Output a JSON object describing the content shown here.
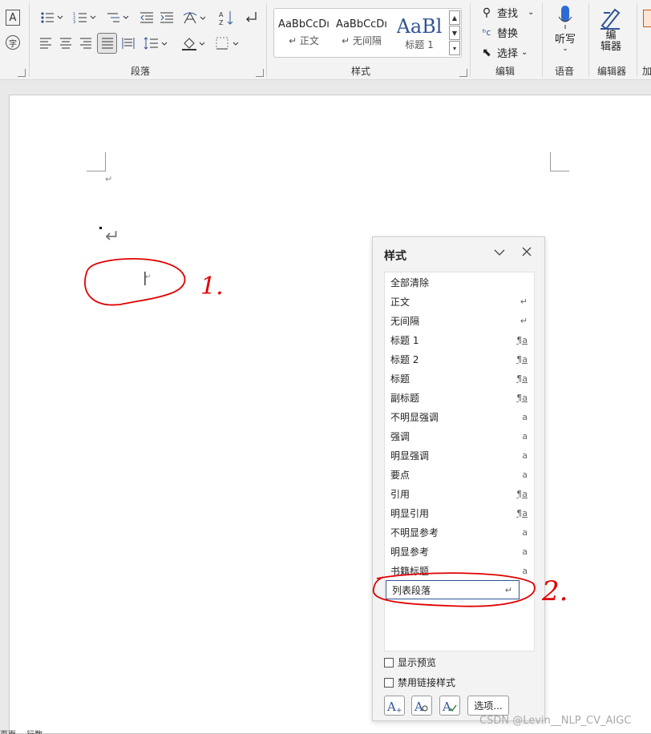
{
  "ribbon": {
    "groups": {
      "paragraph": "段落",
      "styles": "样式",
      "editing": "编辑",
      "voice": "语音",
      "editor": "编辑器"
    },
    "left_icons": {
      "char_border": "A",
      "phonetic": "字"
    },
    "style_gallery": [
      {
        "sample": "AaBbCcDı",
        "label": "↵ 正文"
      },
      {
        "sample": "AaBbCcDı",
        "label": "↵ 无间隔"
      },
      {
        "sample": "AaBl",
        "label": "标题 1"
      }
    ],
    "editing": {
      "find": "查找",
      "replace": "替换",
      "select": "选择"
    },
    "voice_button": "听写",
    "editor_button": "编\n辑器",
    "addin_fragment": "加"
  },
  "document": {
    "return_mark": "↵",
    "cursor_mark": "|"
  },
  "styles_pane": {
    "title": "样式",
    "styles": [
      {
        "name": "全部清除",
        "mark": ""
      },
      {
        "name": "正文",
        "mark": "↵"
      },
      {
        "name": "无间隔",
        "mark": "↵"
      },
      {
        "name": "标题 1",
        "mark": "¶a"
      },
      {
        "name": "标题 2",
        "mark": "¶a"
      },
      {
        "name": "标题",
        "mark": "¶a"
      },
      {
        "name": "副标题",
        "mark": "¶a"
      },
      {
        "name": "不明显强调",
        "mark": "a"
      },
      {
        "name": "强调",
        "mark": "a"
      },
      {
        "name": "明显强调",
        "mark": "a"
      },
      {
        "name": "要点",
        "mark": "a"
      },
      {
        "name": "引用",
        "mark": "¶a"
      },
      {
        "name": "明显引用",
        "mark": "¶a"
      },
      {
        "name": "不明显参考",
        "mark": "a"
      },
      {
        "name": "明显参考",
        "mark": "a"
      },
      {
        "name": "书籍标题",
        "mark": "a"
      },
      {
        "name": "列表段落",
        "mark": "↵",
        "selected": true
      }
    ],
    "show_preview": "显示预览",
    "disable_linked": "禁用链接样式",
    "options_button": "选项..."
  },
  "annotations": {
    "one": "1.",
    "two": "2."
  },
  "watermark": "CSDN @Levin__NLP_CV_AIGC",
  "status_fragment": "页面… 行数…",
  "colors": {
    "accent": "#2f5496",
    "annotation_red": "#e00000"
  }
}
